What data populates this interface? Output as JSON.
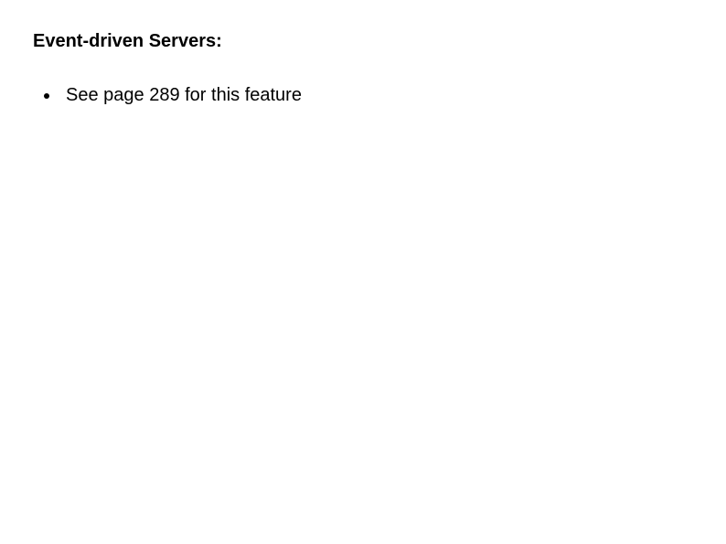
{
  "heading": "Event-driven Servers:",
  "bullets": [
    {
      "text": "See page 289 for this feature"
    }
  ]
}
